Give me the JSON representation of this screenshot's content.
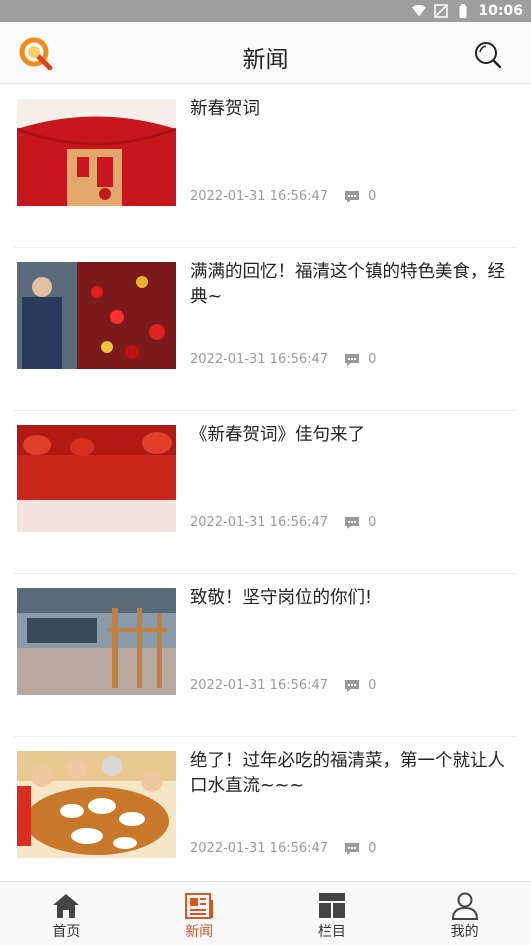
{
  "status_bar": {
    "time": "10:06"
  },
  "header": {
    "title": "新闻"
  },
  "colors": {
    "accent": "#d9541e",
    "logo": "#f08c1a"
  },
  "articles": [
    {
      "title": "新春贺词",
      "date": "2022-01-31 16:56:47",
      "comments": "0",
      "thumb_icon": "red-envelope-fu-image"
    },
    {
      "title": "满满的回忆！福清这个镇的特色美食，经典~",
      "date": "2022-01-31 16:56:47",
      "comments": "0",
      "thumb_icon": "market-decorations-image"
    },
    {
      "title": "《新春贺词》佳句来了",
      "date": "2022-01-31 16:56:47",
      "comments": "0",
      "thumb_icon": "red-lanterns-image"
    },
    {
      "title": "致敬！坚守岗位的你们!",
      "date": "2022-01-31 16:56:47",
      "comments": "0",
      "thumb_icon": "factory-workshop-image"
    },
    {
      "title": "绝了！过年必吃的福清菜，第一个就让人口水直流~~~",
      "date": "2022-01-31 16:56:47",
      "comments": "0",
      "thumb_icon": "family-dinner-image"
    }
  ],
  "tabs": [
    {
      "label": "首页",
      "icon": "home-icon",
      "active": false
    },
    {
      "label": "新闻",
      "icon": "news-icon",
      "active": true
    },
    {
      "label": "栏目",
      "icon": "columns-icon",
      "active": false
    },
    {
      "label": "我的",
      "icon": "profile-icon",
      "active": false
    }
  ]
}
